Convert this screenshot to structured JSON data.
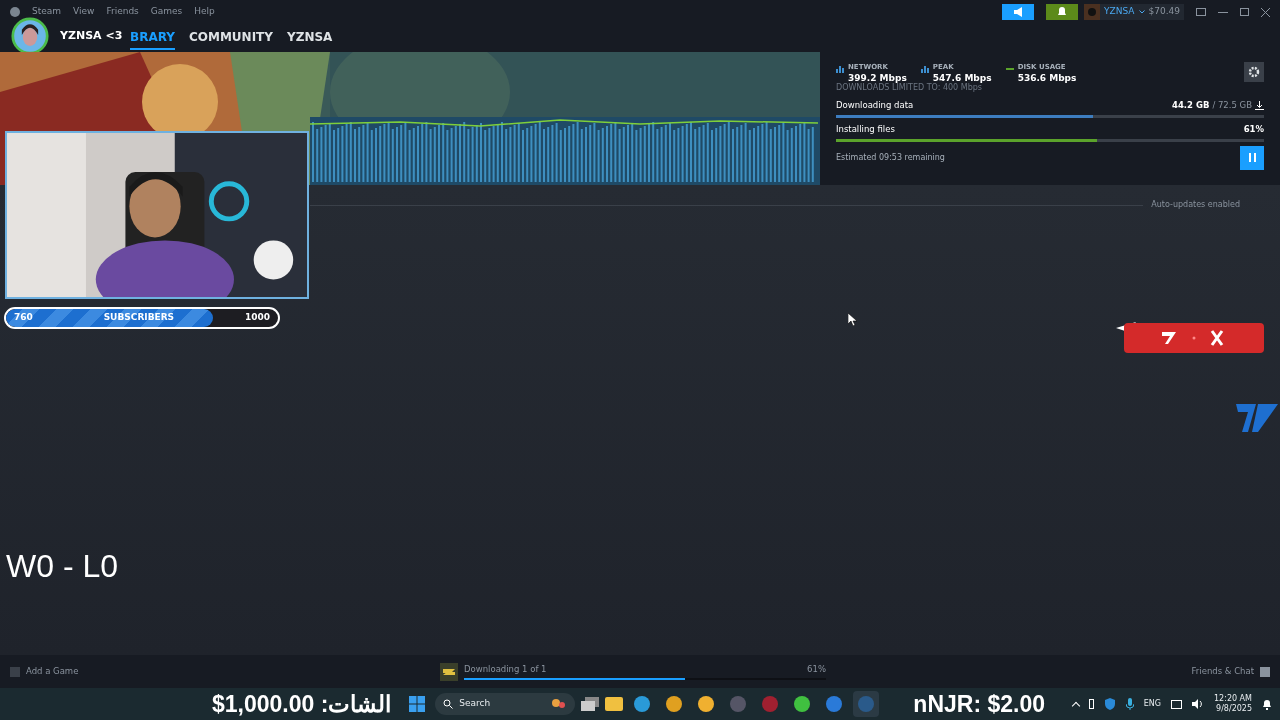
{
  "menu": [
    "Steam",
    "View",
    "Friends",
    "Games",
    "Help"
  ],
  "nav": [
    {
      "label": "BRARY",
      "selected": true
    },
    {
      "label": "COMMUNITY",
      "selected": false
    },
    {
      "label": "YZNSA",
      "selected": false
    }
  ],
  "streamer_tag": "YZNSA <3",
  "account": {
    "name": "YZNSA",
    "wallet": "$70.49"
  },
  "download": {
    "stats": [
      {
        "kind": "bars",
        "label": "NETWORK",
        "value": "399.2 Mbps"
      },
      {
        "kind": "bars",
        "label": "PEAK",
        "value": "547.6 Mbps"
      },
      {
        "kind": "line",
        "label": "DISK USAGE",
        "value": "536.6 Mbps"
      }
    ],
    "limit": "DOWNLOADS LIMITED TO: 400 Mbps",
    "progress": [
      {
        "label": "Downloading data",
        "reading": "44.2 GB",
        "total": "/ 72.5 GB",
        "level": 0.6,
        "color": "#3d7dbf"
      },
      {
        "label": "Installing files",
        "reading": "61%",
        "level": 0.61,
        "color": "#5ba32b"
      }
    ],
    "estimate": "Estimated 09:53 remaining"
  },
  "auto_updates": "Auto-updates enabled",
  "subscriber_goal": {
    "current": "760",
    "label": "SUBSCRIBERS",
    "goal": "1000",
    "level": 0.76
  },
  "score": "W0 - L0",
  "bottom_bar": {
    "add_game": "Add a Game",
    "status": "Downloading 1 of 1",
    "percent": "61%",
    "level": 0.61,
    "friends": "Friends & Chat"
  },
  "taskbar": {
    "donation": "الشات: 1,000.00$",
    "search": "Search",
    "tip": "nNJR: $2.00",
    "language": "ENG",
    "time": "12:20 AM",
    "date": "9/8/2025"
  }
}
